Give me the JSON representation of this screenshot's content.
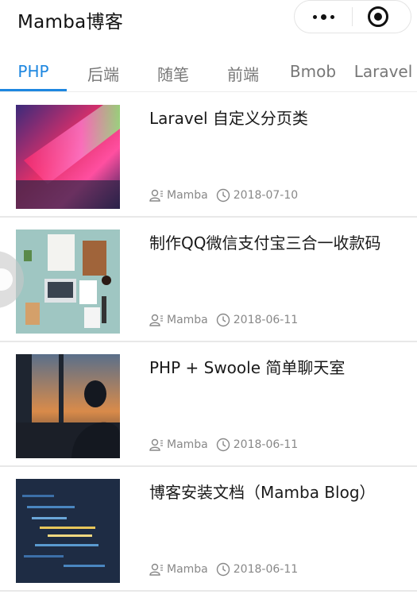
{
  "app": {
    "title": "Mamba博客"
  },
  "capsule": {
    "more_icon": "more-dots-icon",
    "close_icon": "target-close-icon"
  },
  "tabs": [
    {
      "label": "PHP",
      "active": true
    },
    {
      "label": "后端",
      "active": false
    },
    {
      "label": "随笔",
      "active": false
    },
    {
      "label": "前端",
      "active": false
    },
    {
      "label": "Bmob",
      "active": false
    },
    {
      "label": "Laravel",
      "active": false
    }
  ],
  "articles": [
    {
      "title": "Laravel 自定义分页类",
      "author": "Mamba",
      "date": "2018-07-10",
      "thumb": "laptop-neon-keyboard"
    },
    {
      "title": "制作QQ微信支付宝三合一收款码",
      "author": "Mamba",
      "date": "2018-06-11",
      "thumb": "desk-flatlay"
    },
    {
      "title": "PHP + Swoole 简单聊天室",
      "author": "Mamba",
      "date": "2018-06-11",
      "thumb": "window-sunset-silhouette"
    },
    {
      "title": "博客安装文档（Mamba Blog）",
      "author": "Mamba",
      "date": "2018-06-11",
      "thumb": "code-screen"
    }
  ],
  "colors": {
    "accent": "#1e87e0",
    "meta": "#888888"
  }
}
